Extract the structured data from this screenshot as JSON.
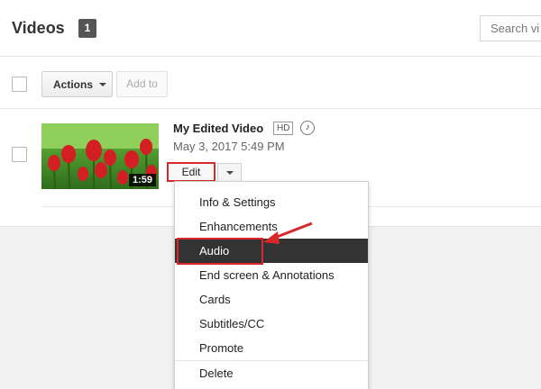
{
  "header": {
    "title": "Videos",
    "count": "1",
    "search_placeholder": "Search vi"
  },
  "toolbar": {
    "actions_label": "Actions",
    "add_to_label": "Add to"
  },
  "video": {
    "title": "My Edited Video",
    "hd_badge": "HD",
    "date": "May 3, 2017 5:49 PM",
    "duration": "1:59",
    "edit_label": "Edit"
  },
  "menu": {
    "items": [
      {
        "label": "Info & Settings"
      },
      {
        "label": "Enhancements"
      },
      {
        "label": "Audio"
      },
      {
        "label": "End screen & Annotations"
      },
      {
        "label": "Cards"
      },
      {
        "label": "Subtitles/CC"
      },
      {
        "label": "Promote"
      },
      {
        "label": "Delete"
      }
    ],
    "selected": "Audio"
  },
  "colors": {
    "highlight": "#d9282c",
    "selected_bg": "#333333",
    "badge_bg": "#555555"
  },
  "icons": {
    "dropdown": "caret-down-icon",
    "audio": "music-note-icon"
  }
}
